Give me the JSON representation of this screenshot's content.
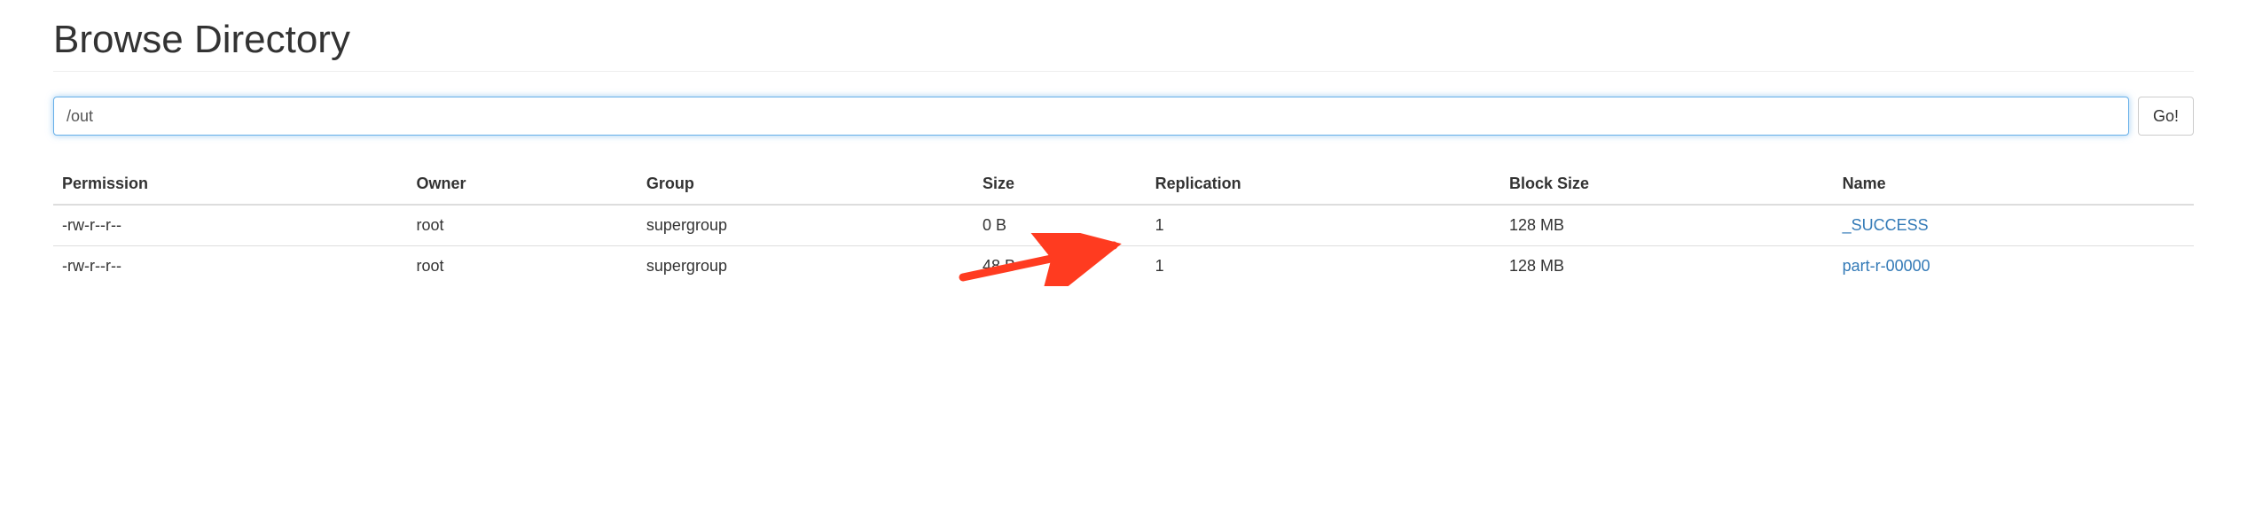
{
  "title": "Browse Directory",
  "path_input": {
    "value": "/out",
    "placeholder": ""
  },
  "go_button_label": "Go!",
  "columns": [
    "Permission",
    "Owner",
    "Group",
    "Size",
    "Replication",
    "Block Size",
    "Name"
  ],
  "rows": [
    {
      "permission": "-rw-r--r--",
      "owner": "root",
      "group": "supergroup",
      "size": "0 B",
      "replication": "1",
      "block_size": "128 MB",
      "name": "_SUCCESS"
    },
    {
      "permission": "-rw-r--r--",
      "owner": "root",
      "group": "supergroup",
      "size": "48 B",
      "replication": "1",
      "block_size": "128 MB",
      "name": "part-r-00000"
    }
  ],
  "annotation": {
    "arrow_color": "#ff3b20",
    "target": "part-r-00000"
  }
}
